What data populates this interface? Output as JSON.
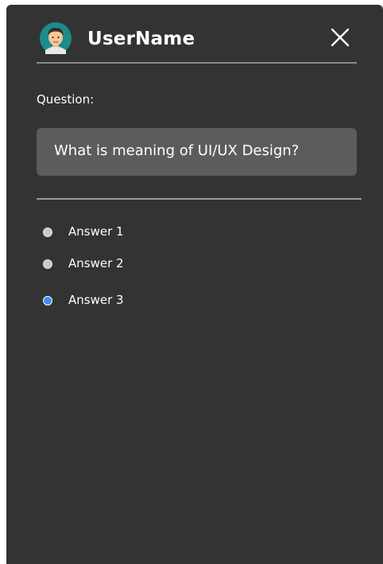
{
  "header": {
    "username": "UserName",
    "avatar_icon": "user-avatar-icon",
    "close_icon": "close-icon"
  },
  "question": {
    "label": "Question:",
    "text": "What is meaning of UI/UX Design?"
  },
  "answers": [
    {
      "label": "Answer 1",
      "selected": false
    },
    {
      "label": "Answer 2",
      "selected": false
    },
    {
      "label": "Answer 3",
      "selected": true
    }
  ],
  "colors": {
    "panel_bg": "#333333",
    "question_box_bg": "#5c5c5c",
    "radio_unselected": "#c8c8c8",
    "radio_selected": "#3e8ff0",
    "text": "#ffffff"
  }
}
